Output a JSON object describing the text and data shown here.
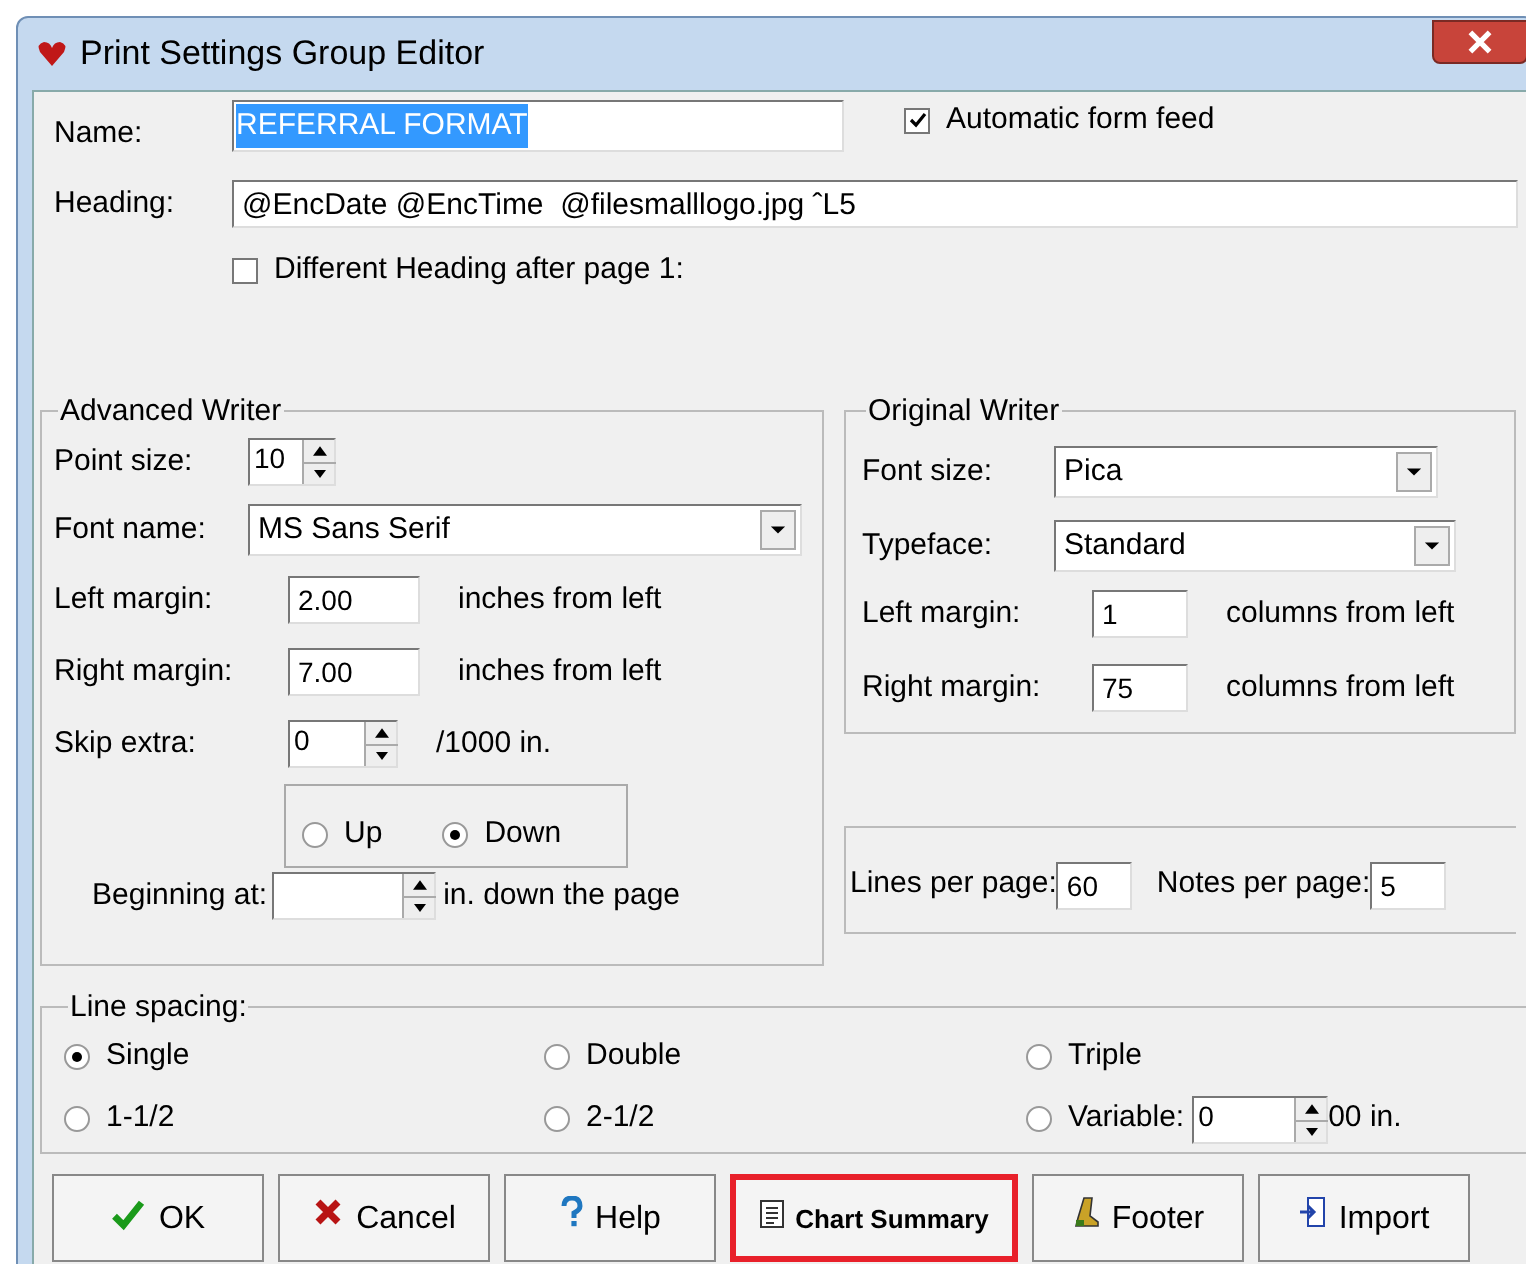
{
  "window": {
    "title": "Print Settings Group Editor"
  },
  "name": {
    "label": "Name:",
    "value": "REFERRAL FORMAT",
    "text_selected": true
  },
  "automatic_form_feed": {
    "label": "Automatic form feed",
    "checked": true
  },
  "heading": {
    "label": "Heading:",
    "value": "@EncDate @EncTime  @filesmalllogo.jpg ˆL5"
  },
  "different_heading": {
    "label": "Different Heading after page 1:",
    "checked": false
  },
  "advanced_writer": {
    "title": "Advanced Writer",
    "point_size": {
      "label": "Point size:",
      "value": "10"
    },
    "font_name": {
      "label": "Font name:",
      "value": "MS Sans Serif"
    },
    "left_margin": {
      "label": "Left margin:",
      "value": "2.00",
      "unit": "inches from left"
    },
    "right_margin": {
      "label": "Right margin:",
      "value": "7.00",
      "unit": "inches from left"
    },
    "skip_extra": {
      "label": "Skip extra:",
      "value": "0",
      "unit": "/1000 in."
    },
    "direction": [
      {
        "label": "Up",
        "selected": false
      },
      {
        "label": "Down",
        "selected": true
      }
    ],
    "beginning_at": {
      "label": "Beginning at:",
      "unit": "in. down the page"
    }
  },
  "original_writer": {
    "title": "Original Writer",
    "font_size": {
      "label": "Font size:",
      "value": "Pica"
    },
    "typeface": {
      "label": "Typeface:",
      "value": "Standard"
    },
    "left_margin": {
      "label": "Left margin:",
      "value": "1",
      "unit": "columns from left"
    },
    "right_margin": {
      "label": "Right margin:",
      "value": "75",
      "unit": "columns from left"
    }
  },
  "lines_per_page": {
    "label": "Lines per page:",
    "value": "60"
  },
  "notes_per_page": {
    "label": "Notes per page:",
    "value": "5"
  },
  "line_spacing": {
    "title": "Line spacing:",
    "options": [
      {
        "label": "Single",
        "selected": true
      },
      {
        "label": "Double",
        "selected": false
      },
      {
        "label": "Triple",
        "selected": false
      },
      {
        "label": "1-1/2",
        "selected": false
      },
      {
        "label": "2-1/2",
        "selected": false
      },
      {
        "label": "Variable:",
        "selected": false
      }
    ],
    "variable_value": "0",
    "variable_unit": "00 in."
  },
  "buttons": [
    {
      "label": "OK",
      "kind": "check",
      "highlighted": false
    },
    {
      "label": "Cancel",
      "kind": "cross",
      "highlighted": false
    },
    {
      "label": "Help",
      "kind": "question",
      "highlighted": false
    },
    {
      "label": "Chart Summary",
      "kind": "document",
      "highlighted": true
    },
    {
      "label": "Footer",
      "kind": "boot",
      "highlighted": false
    },
    {
      "label": "Import",
      "kind": "import",
      "highlighted": false
    }
  ]
}
